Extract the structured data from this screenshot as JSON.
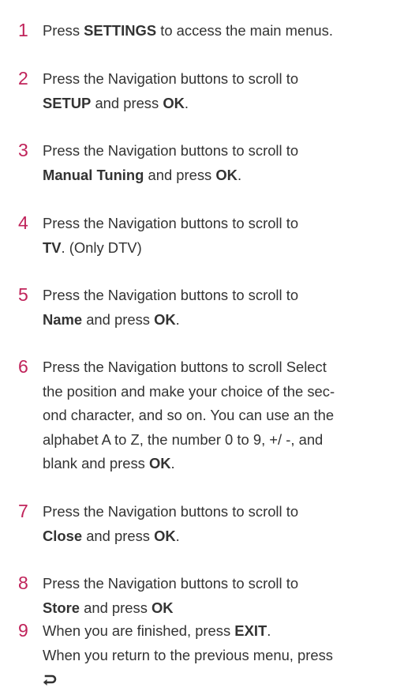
{
  "steps": [
    {
      "number": "1",
      "pre": "Press ",
      "bold": "SETTINGS",
      "post": " to access the main menus."
    },
    {
      "number": "2",
      "line1": "Press the Navigation buttons to scroll to",
      "bold1": "SETUP",
      "mid": " and press ",
      "bold2": "OK",
      "end": "."
    },
    {
      "number": "3",
      "line1": "Press the Navigation buttons to scroll to",
      "bold1": "Manual Tuning",
      "mid": " and press ",
      "bold2": "OK",
      "end": "."
    },
    {
      "number": "4",
      "line1": "Press the Navigation buttons to scroll to",
      "bold1": "TV",
      "end": ". (Only DTV)"
    },
    {
      "number": "5",
      "line1": "Press the Navigation buttons to scroll to",
      "bold1": "Name",
      "mid": " and press ",
      "bold2": "OK",
      "end": "."
    },
    {
      "number": "6",
      "line1": "Press the Navigation buttons to scroll Select",
      "line2": "the position and make your choice of the sec-",
      "line3": "ond character, and so on. You can use an the",
      "line4": "alphabet A to Z, the number 0 to 9, +/ -, and",
      "line5": "blank and press ",
      "bold1": "OK",
      "end": "."
    },
    {
      "number": "7",
      "line1": "Press the Navigation buttons to scroll to",
      "bold1": "Close",
      "mid": " and press ",
      "bold2": "OK",
      "end": "."
    },
    {
      "number": "8",
      "line1": "Press the Navigation buttons to scroll to",
      "bold1": "Store",
      "mid": " and press ",
      "bold2": "OK"
    },
    {
      "number": "9",
      "line1": "When you are finished, press ",
      "bold1": "EXIT",
      "end": ".",
      "line2": "When you return to the previous menu, press",
      "icon": "return-back-icon"
    }
  ],
  "colors": {
    "number": "#c0235a",
    "text": "#333333"
  }
}
